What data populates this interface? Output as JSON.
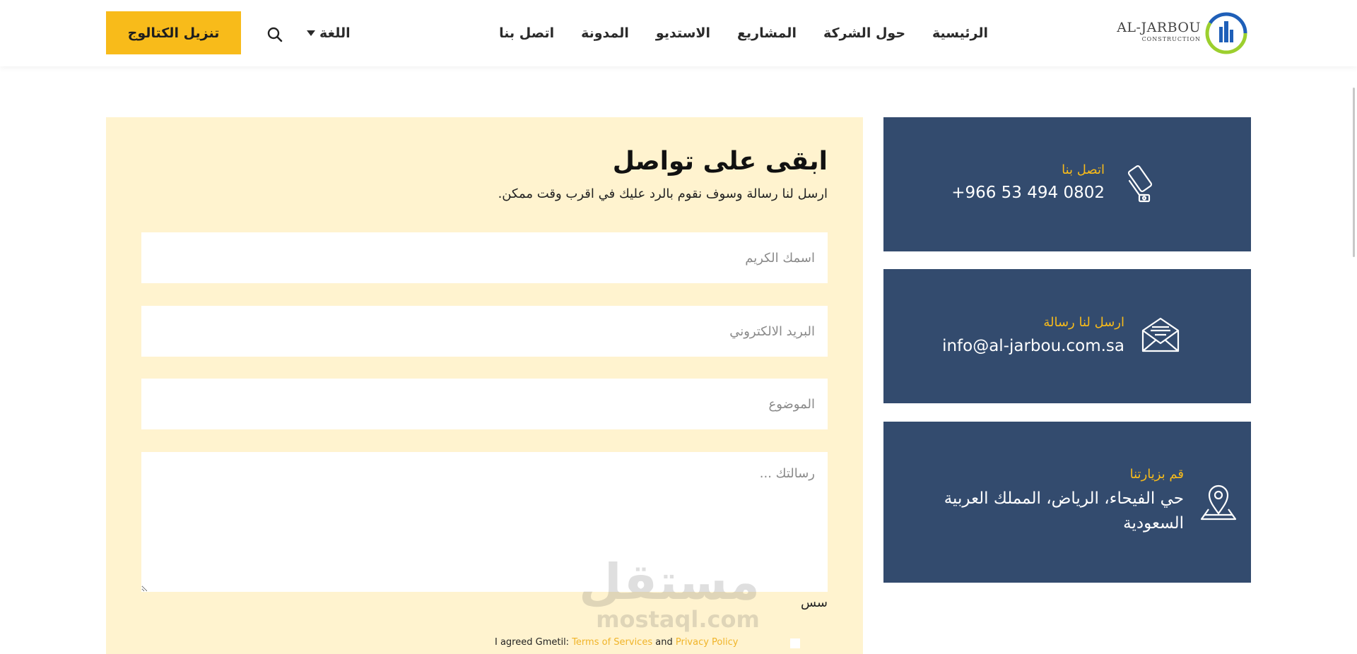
{
  "header": {
    "logo_text": "AL-JARBOU",
    "logo_sub": "CONSTRUCTION",
    "nav": [
      "الرئيسية",
      "حول الشركة",
      "المشاريع",
      "الاستديو",
      "المدونة",
      "اتصل بنا"
    ],
    "language_label": "اللغة",
    "cta_label": "تنزيل الكتالوج"
  },
  "form": {
    "title": "ابقى على تواصل",
    "subtitle": "ارسل لنا رسالة وسوف نقوم بالرد عليك في اقرب وقت ممكن.",
    "name_placeholder": "اسمك الكريم",
    "email_placeholder": "البريد الالكتروني",
    "subject_placeholder": "الموضوع",
    "message_placeholder": "رسالتك ...",
    "extra_text": "سس",
    "terms_prefix": "I agreed Gmetil:",
    "terms_link": "Terms of Services",
    "terms_and": "and",
    "privacy_link": "Privacy Policy"
  },
  "cards": {
    "call": {
      "label": "اتصل بنا",
      "value": "+966 53 494 0802"
    },
    "mail": {
      "label": "ارسل لنا رسالة",
      "value": "info@al-jarbou.com.sa"
    },
    "visit": {
      "label": "قم بزيارتنا",
      "value_line1": "حي الفيحاء، الرياض، المملك العربية",
      "value_line2": "السعودية"
    }
  },
  "watermark": {
    "arabic": "مستقل",
    "english": "mostaql.com"
  },
  "colors": {
    "accent": "#f8bb1a",
    "card_bg": "#334b6e",
    "form_bg": "#fff3cf"
  }
}
